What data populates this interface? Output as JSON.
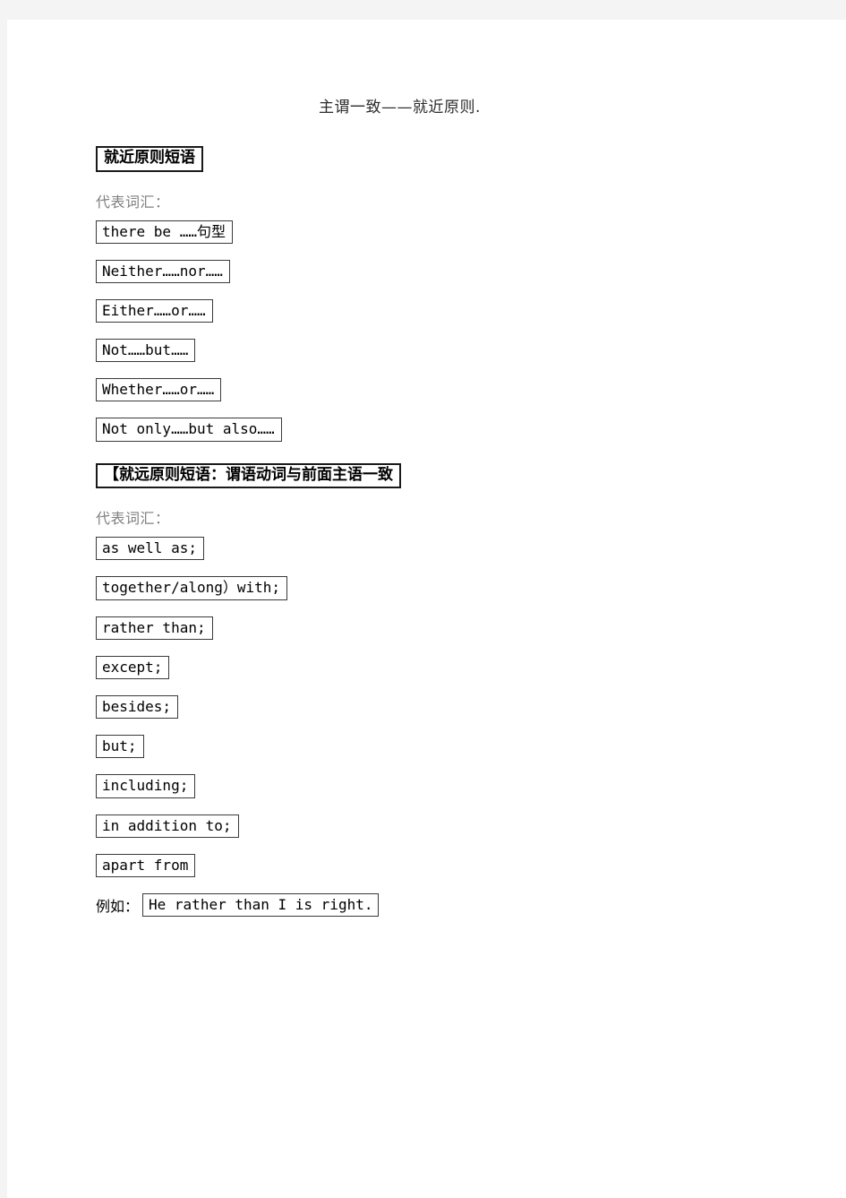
{
  "document": {
    "title": "主谓一致——就近原则.",
    "sections": [
      {
        "heading": "就近原则短语",
        "sub_label": "代表词汇：",
        "phrases": [
          "there be ……句型",
          "Neither……nor……",
          "Either……or……",
          "Not……but……",
          "Whether……or……",
          "Not only……but also……"
        ]
      },
      {
        "heading": "【就远原则短语：谓语动词与前面主语一致",
        "sub_label": "代表词汇：",
        "phrases": [
          "as well as;",
          "together/along）with;",
          "rather than;",
          "except;",
          "besides;",
          "but;",
          "including;",
          "in addition to;",
          "apart from"
        ]
      }
    ],
    "example": {
      "label": "例如：",
      "sentence": "He rather than I is right."
    }
  },
  "colors": {
    "page_background": "#ffffff",
    "canvas_background": "#f4f4f4",
    "title_text": "#2b2b2b",
    "sub_label_text": "#808080",
    "box_border": "#3a3a3a",
    "heading_border": "#1a1a1a"
  }
}
